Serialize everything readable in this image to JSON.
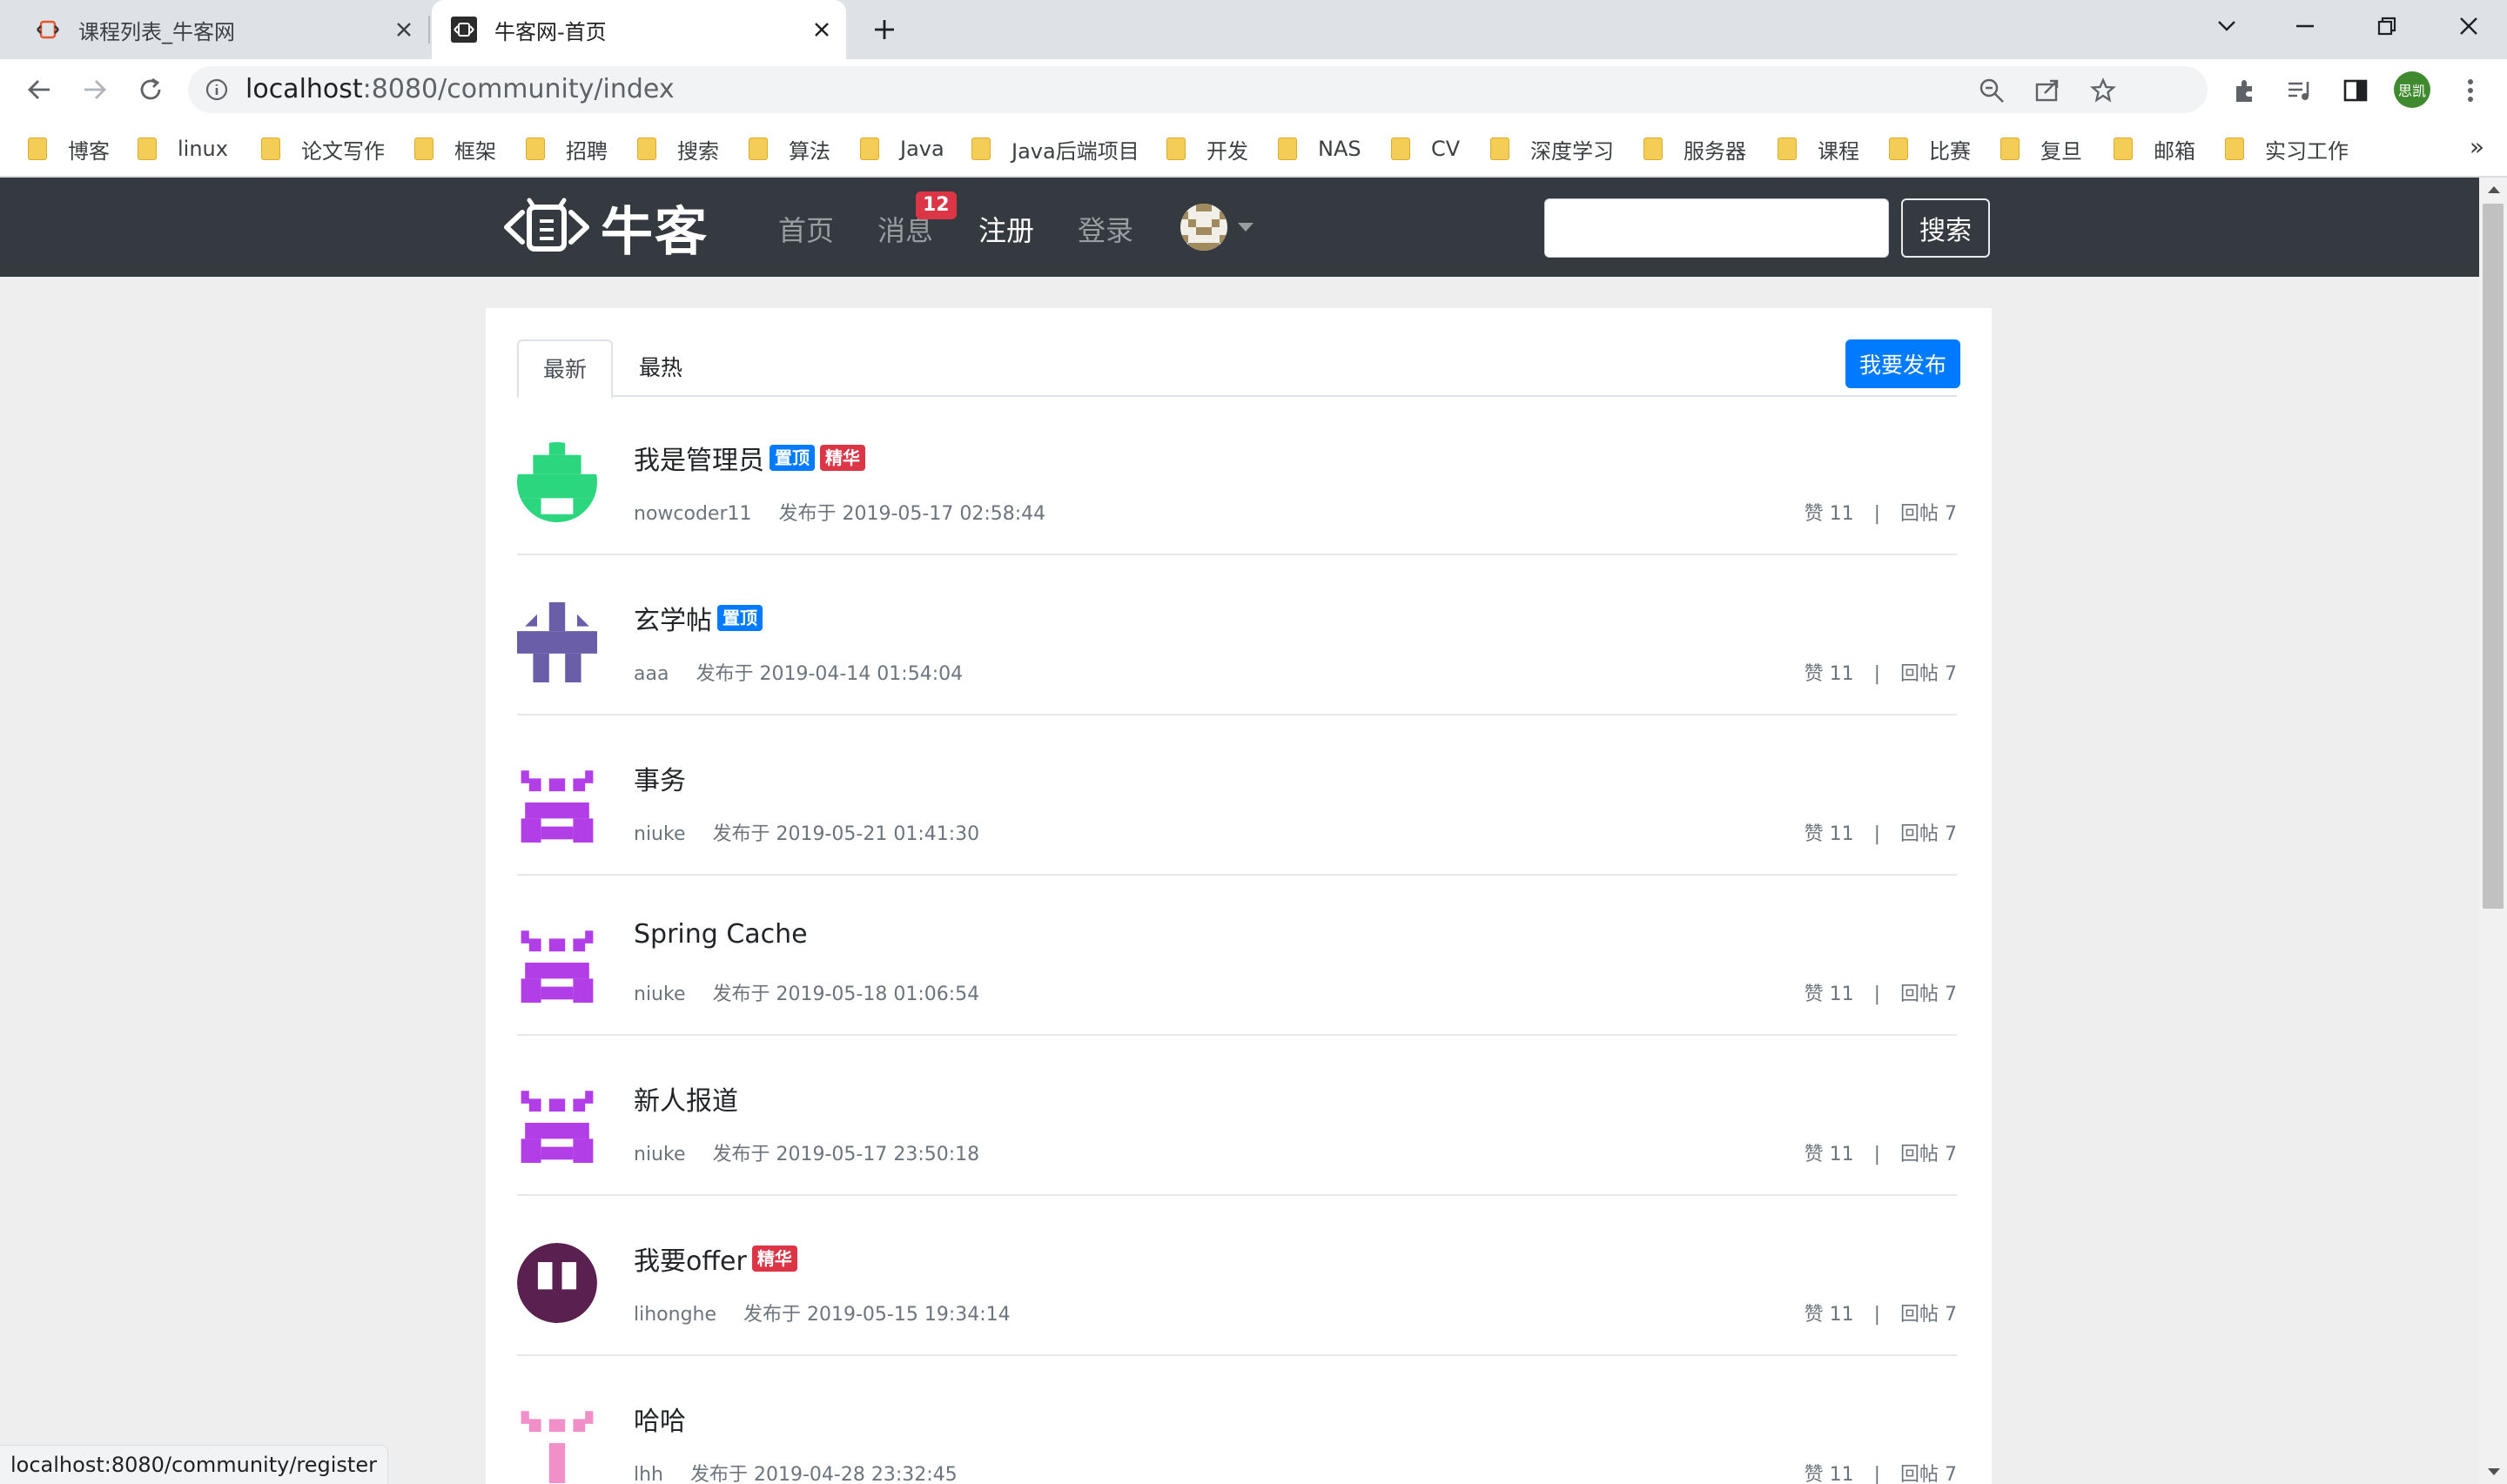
{
  "browser": {
    "tabs": [
      {
        "title": "课程列表_牛客网",
        "active": false
      },
      {
        "title": "牛客网-首页",
        "active": true
      }
    ],
    "url": {
      "host": "localhost",
      "path": ":8080/community/index"
    },
    "profile_label": "思凯",
    "bookmarks": [
      "博客",
      "linux",
      "论文写作",
      "框架",
      "招聘",
      "搜索",
      "算法",
      "Java",
      "Java后端项目",
      "开发",
      "NAS",
      "CV",
      "深度学习",
      "服务器",
      "课程",
      "比赛",
      "复旦",
      "邮箱",
      "实习工作"
    ],
    "bookmarks_more": "»",
    "status_url": "localhost:8080/community/register"
  },
  "site": {
    "logo_text": "牛客",
    "nav": {
      "home": "首页",
      "messages": "消息",
      "messages_badge": "12",
      "register": "注册",
      "login": "登录"
    },
    "search": {
      "placeholder": "",
      "button": "搜索"
    }
  },
  "main": {
    "tabs": [
      {
        "label": "最新",
        "active": true
      },
      {
        "label": "最热",
        "active": false
      }
    ],
    "publish_button": "我要发布",
    "posts": [
      {
        "title": "我是管理员",
        "top": true,
        "wonderful": true,
        "author": "nowcoder11",
        "time": "发布于 2019-05-17 02:58:44",
        "likes": "赞 11",
        "replies": "回帖 7",
        "avatar_color": "#2bd67e",
        "avatar_style": "plug"
      },
      {
        "title": "玄学帖",
        "top": true,
        "wonderful": false,
        "author": "aaa",
        "time": "发布于 2019-04-14 01:54:04",
        "likes": "赞 11",
        "replies": "回帖 7",
        "avatar_color": "#6b5ea8",
        "avatar_style": "cross"
      },
      {
        "title": "事务",
        "top": false,
        "wonderful": false,
        "author": "niuke",
        "time": "发布于 2019-05-21 01:41:30",
        "likes": "赞 11",
        "replies": "回帖 7",
        "avatar_color": "#b23ee8",
        "avatar_style": "face"
      },
      {
        "title": "Spring Cache",
        "top": false,
        "wonderful": false,
        "author": "niuke",
        "time": "发布于 2019-05-18 01:06:54",
        "likes": "赞 11",
        "replies": "回帖 7",
        "avatar_color": "#b23ee8",
        "avatar_style": "face"
      },
      {
        "title": "新人报道",
        "top": false,
        "wonderful": false,
        "author": "niuke",
        "time": "发布于 2019-05-17 23:50:18",
        "likes": "赞 11",
        "replies": "回帖 7",
        "avatar_color": "#b23ee8",
        "avatar_style": "face"
      },
      {
        "title": "我要offer",
        "top": false,
        "wonderful": true,
        "author": "lihonghe",
        "time": "发布于 2019-05-15 19:34:14",
        "likes": "赞 11",
        "replies": "回帖 7",
        "avatar_color": "#5a2150",
        "avatar_style": "bars"
      },
      {
        "title": "哈哈",
        "top": false,
        "wonderful": false,
        "author": "lhh",
        "time": "发布于 2019-04-28 23:32:45",
        "likes": "赞 11",
        "replies": "回帖 7",
        "avatar_color": "#f08fc8",
        "avatar_style": "face2"
      }
    ],
    "tag_top": "置顶",
    "tag_wonderful": "精华",
    "stats_separator": "|"
  }
}
